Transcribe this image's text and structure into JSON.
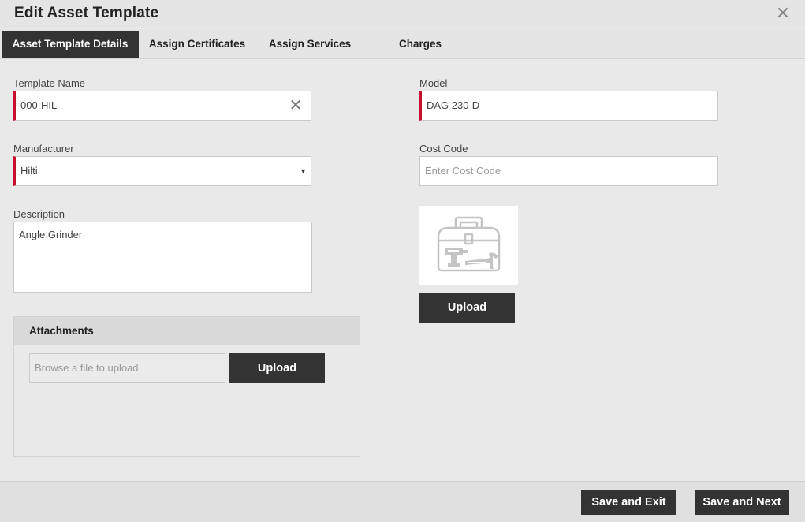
{
  "window": {
    "title": "Edit Asset Template",
    "close_icon": "close-icon"
  },
  "tabs": [
    {
      "label": "Asset Template Details",
      "active": true
    },
    {
      "label": "Assign Certificates",
      "active": false
    },
    {
      "label": "Assign Services",
      "active": false
    },
    {
      "label": "Charges",
      "active": false
    }
  ],
  "form": {
    "template_name": {
      "label": "Template Name",
      "value": "000-HIL"
    },
    "model": {
      "label": "Model",
      "value": "DAG 230-D"
    },
    "manufacturer": {
      "label": "Manufacturer",
      "value": "Hilti"
    },
    "cost_code": {
      "label": "Cost Code",
      "placeholder": "Enter Cost Code"
    },
    "description": {
      "label": "Description",
      "value": "Angle Grinder"
    }
  },
  "image": {
    "icon": "toolbox-icon",
    "upload_label": "Upload"
  },
  "attachments": {
    "title": "Attachments",
    "placeholder": "Browse a file to upload",
    "upload_label": "Upload"
  },
  "footer": {
    "save_exit_label": "Save and Exit",
    "save_next_label": "Save and Next"
  },
  "colors": {
    "accent": "#c8102e",
    "dark_button": "#333333"
  }
}
